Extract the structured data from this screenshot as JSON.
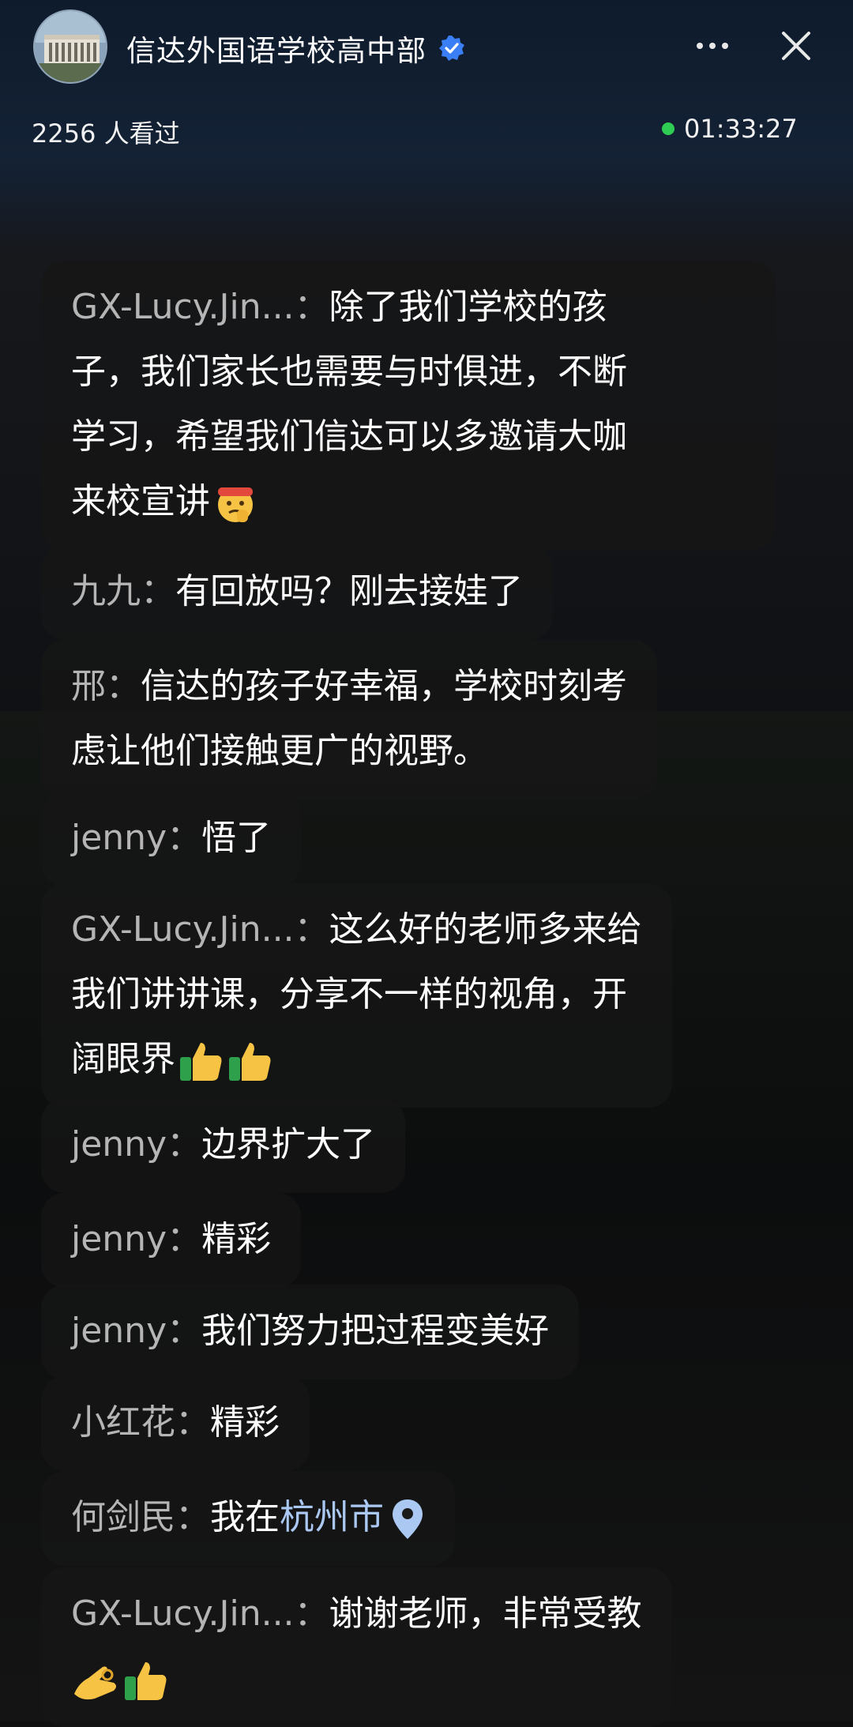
{
  "header": {
    "channel_name": "信达外国语学校高中部",
    "viewers": "2256 人看过",
    "duration": "01:33:27"
  },
  "colors": {
    "live": "#2ecc52",
    "verified": "#3a7ff5",
    "username": "#b5b5b5",
    "location_link": "#aac8f2"
  },
  "icons": {
    "verified": "verified-badge-icon",
    "more": "more-dots-icon",
    "close": "close-icon",
    "location": "location-pin-icon"
  },
  "comments": [
    {
      "user": "GX-Lucy.Jin...",
      "lines": [
        "除了我们学校的孩",
        "子，我们家长也需要与时俱进，不断",
        "学习，希望我们信达可以多邀请大咖",
        "来校宣讲"
      ],
      "emoji": "thinking-salute"
    },
    {
      "user": "九九",
      "lines": [
        "有回放吗？刚去接娃了"
      ]
    },
    {
      "user": "邢",
      "lines": [
        "信达的孩子好幸福，学校时刻考",
        "虑让他们接触更广的视野。"
      ]
    },
    {
      "user": "jenny",
      "lines": [
        "悟了"
      ]
    },
    {
      "user": "GX-Lucy.Jin...",
      "lines": [
        "这么好的老师多来给",
        "我们讲讲课，分享不一样的视角，开",
        "阔眼界"
      ],
      "emoji": "thumbs-up x2"
    },
    {
      "user": "jenny",
      "lines": [
        "边界扩大了"
      ]
    },
    {
      "user": "jenny",
      "lines": [
        "精彩"
      ]
    },
    {
      "user": "jenny",
      "lines": [
        "我们努力把过程变美好"
      ]
    },
    {
      "user": "小红花",
      "lines": [
        "精彩"
      ]
    },
    {
      "user": "何剑民",
      "lines": [
        "我在"
      ],
      "location": "杭州市"
    },
    {
      "user": "GX-Lucy.Jin...",
      "lines": [
        "谢谢老师，非常受教"
      ],
      "emoji": "ok-hand thumbs-up"
    }
  ]
}
